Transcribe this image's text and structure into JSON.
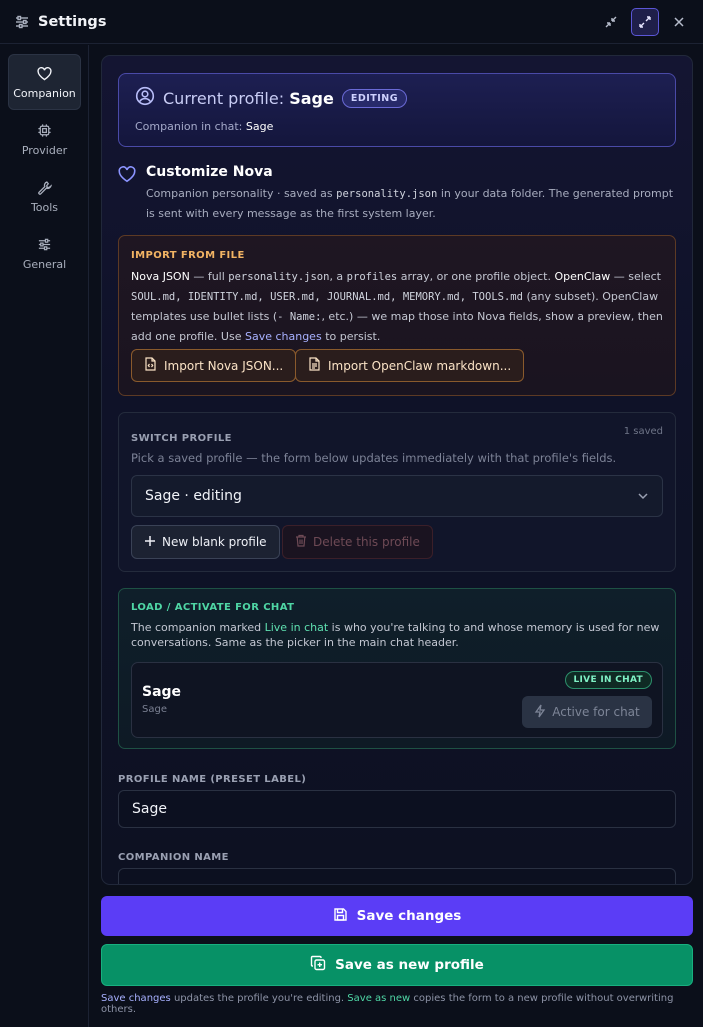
{
  "header": {
    "title": "Settings"
  },
  "sidebar": {
    "items": [
      {
        "label": "Companion",
        "icon": "heart-icon",
        "active": true
      },
      {
        "label": "Provider",
        "icon": "chip-icon"
      },
      {
        "label": "Tools",
        "icon": "wrench-icon"
      },
      {
        "label": "General",
        "icon": "sliders-icon"
      }
    ]
  },
  "profile_card": {
    "title_prefix": "Current profile:",
    "profile_name": "Sage",
    "badge": "EDITING",
    "companion_label": "Companion in chat:",
    "companion_value": "Sage"
  },
  "customize": {
    "title": "Customize Nova",
    "desc_1": "Companion personality · saved as",
    "desc_file": "personality.json",
    "desc_2": "in your data folder. The generated prompt is sent with every message as the first system layer."
  },
  "import": {
    "title": "IMPORT FROM FILE",
    "nova_json": "Nova JSON",
    "t1": "— full",
    "file1": "personality.json",
    "t2": ", a",
    "file2": "profiles",
    "t3": "array, or one profile object.",
    "openclaw": "OpenClaw",
    "t4": "— select",
    "files": "SOUL.md, IDENTITY.md, USER.md, JOURNAL.md, MEMORY.md, TOOLS.md",
    "t5": "(any subset). OpenClaw templates use bullet lists (",
    "code_name": "- Name:",
    "t6": ", etc.) — we map those into Nova fields, show a preview, then add one profile. Use",
    "save_link": "Save changes",
    "t7": "to persist.",
    "btn_nova": "Import Nova JSON...",
    "btn_openclaw": "Import OpenClaw markdown..."
  },
  "switch": {
    "title": "SWITCH PROFILE",
    "count": "1 saved",
    "desc": "Pick a saved profile — the form below updates immediately with that profile's fields.",
    "selected": "Sage · editing",
    "btn_new": "New blank profile",
    "btn_delete": "Delete this profile"
  },
  "load": {
    "title": "LOAD / ACTIVATE FOR CHAT",
    "t1": "The companion marked",
    "live_link": "Live in chat",
    "t2": "is who you're talking to and whose memory is used for new conversations. Same as the picker in the main chat header.",
    "card_name": "Sage",
    "card_sub": "Sage",
    "badge": "LIVE IN CHAT",
    "active_btn": "Active for chat"
  },
  "fields": {
    "profile_name_label": "PROFILE NAME (PRESET LABEL)",
    "profile_name_value": "Sage",
    "companion_name_label": "COMPANION NAME"
  },
  "actions": {
    "save": "Save changes",
    "save_new": "Save as new profile",
    "foot_save": "Save changes",
    "foot_t1": "updates the profile you're editing.",
    "foot_new": "Save as new",
    "foot_t2": "copies the form to a new profile without overwriting others."
  },
  "colors": {
    "accent": "#5b3df6",
    "success": "#079166",
    "warning": "#f2b464"
  }
}
